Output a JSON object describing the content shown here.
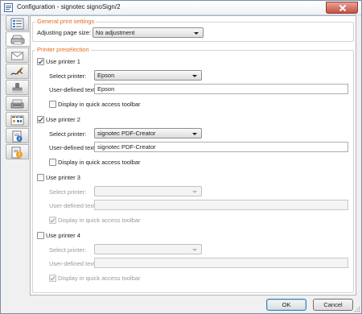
{
  "window": {
    "title": "Configuration - signotec signoSign/2"
  },
  "sidebar": {
    "tabs": [
      {
        "icon": "list-settings-icon"
      },
      {
        "icon": "printer-icon"
      },
      {
        "icon": "envelope-icon"
      },
      {
        "icon": "signature-pen-icon"
      },
      {
        "icon": "stamp-icon"
      },
      {
        "icon": "scanner-icon"
      },
      {
        "icon": "date-calendar-icon"
      },
      {
        "icon": "document-info-icon"
      },
      {
        "icon": "document-warning-icon"
      }
    ]
  },
  "general": {
    "title": "General print settings",
    "page_size_label": "Adjusting page size:",
    "page_size_value": "No adjustment"
  },
  "preselection": {
    "title": "Printer preselection",
    "printers": [
      {
        "label": "Use printer 1",
        "checked": true,
        "select_label": "Select printer:",
        "printer": "Epson",
        "text_label": "User-defined text:",
        "text_value": "Epson",
        "toolbar_label": "Display in quick access toolbar",
        "toolbar_checked": false
      },
      {
        "label": "Use printer 2",
        "checked": true,
        "select_label": "Select printer:",
        "printer": "signotec PDF-Creator",
        "text_label": "User-defined text:",
        "text_value": "signotec PDF-Creator",
        "toolbar_label": "Display in quick access toolbar",
        "toolbar_checked": false
      },
      {
        "label": "Use printer 3",
        "checked": false,
        "select_label": "Select printer:",
        "printer": "",
        "text_label": "User-defined text:",
        "text_value": "",
        "toolbar_label": "Display in quick access toolbar",
        "toolbar_checked": true
      },
      {
        "label": "Use printer 4",
        "checked": false,
        "select_label": "Select printer:",
        "printer": "",
        "text_label": "User-defined text:",
        "text_value": "",
        "toolbar_label": "Display in quick access toolbar",
        "toolbar_checked": true
      }
    ]
  },
  "buttons": {
    "ok": "OK",
    "cancel": "Cancel"
  }
}
